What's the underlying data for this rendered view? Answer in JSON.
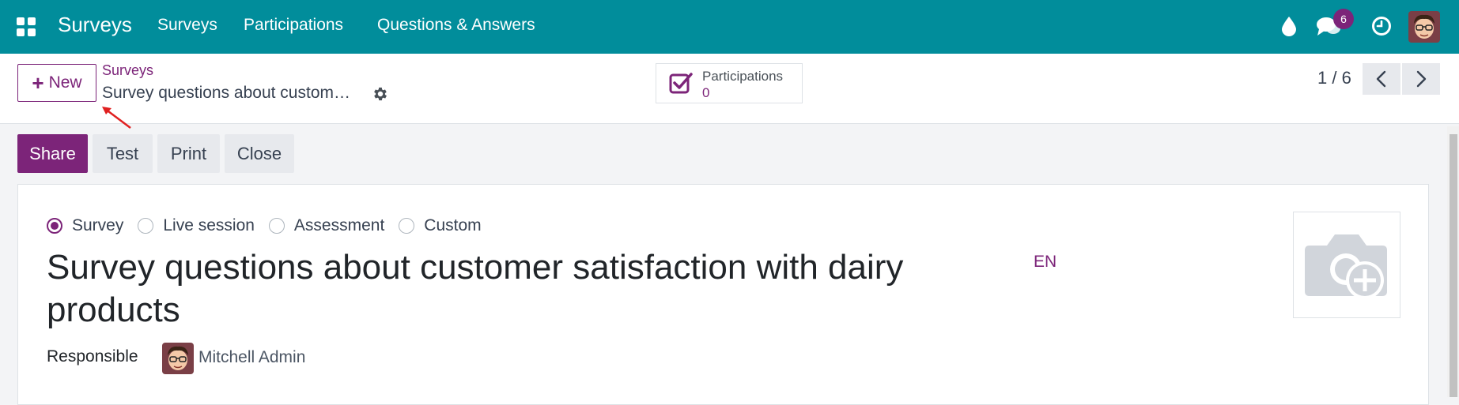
{
  "navbar": {
    "brand": "Surveys",
    "menu": [
      "Surveys",
      "Participations",
      "Questions & Answers"
    ],
    "messages_badge": "6",
    "bg_color": "#018d9b"
  },
  "control_panel": {
    "new_button": "New",
    "breadcrumb_parent": "Surveys",
    "breadcrumb_current": "Survey questions about custom…",
    "stat_button": {
      "label": "Participations",
      "value": "0"
    },
    "pager": "1 / 6"
  },
  "actions": [
    "Share",
    "Test",
    "Print",
    "Close"
  ],
  "form": {
    "survey_types": [
      {
        "label": "Survey",
        "checked": true
      },
      {
        "label": "Live session",
        "checked": false
      },
      {
        "label": "Assessment",
        "checked": false
      },
      {
        "label": "Custom",
        "checked": false
      }
    ],
    "title": "Survey questions about customer satisfaction with dairy products",
    "language": "EN",
    "responsible_label": "Responsible",
    "responsible_name": "Mitchell Admin"
  },
  "icons": [
    "apps-grid-icon",
    "droplet-icon",
    "chat-icon",
    "clock-icon",
    "user-avatar",
    "gear-icon",
    "checkbox-icon",
    "chevron-left-icon",
    "chevron-right-icon",
    "camera-add-icon"
  ],
  "colors": {
    "accent": "#7c2479",
    "navbar": "#018d9b",
    "secondary_button": "#e7e9ed"
  }
}
